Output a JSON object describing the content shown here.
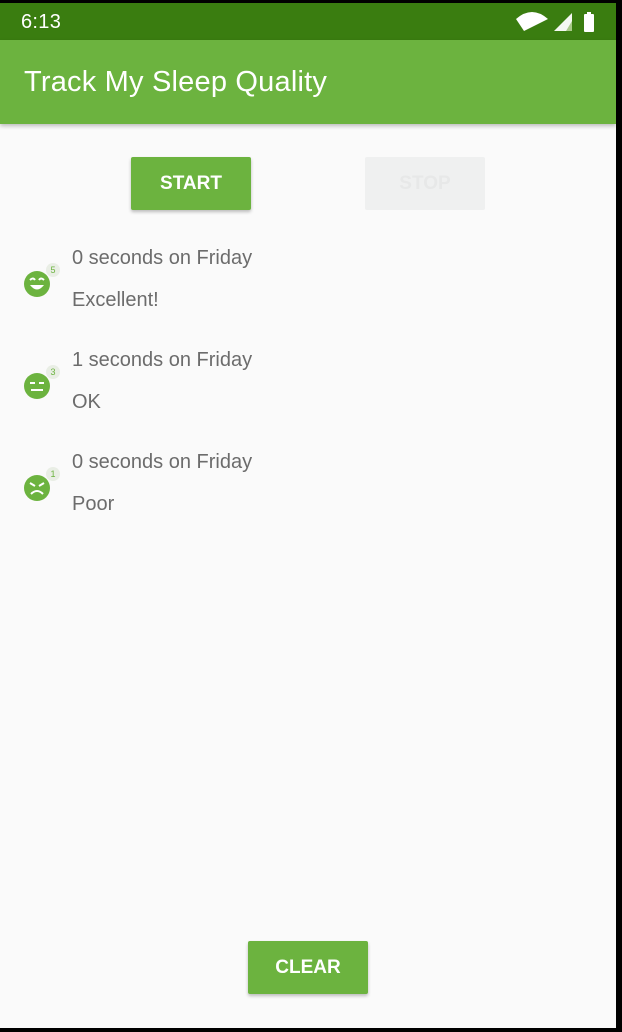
{
  "status_bar": {
    "time": "6:13",
    "icons": [
      "wifi-icon",
      "signal-icon",
      "battery-icon"
    ]
  },
  "app_bar": {
    "title": "Track My Sleep Quality"
  },
  "buttons": {
    "start": "START",
    "stop": "STOP",
    "clear": "CLEAR"
  },
  "nights": [
    {
      "duration": "0 seconds on Friday",
      "quality": "Excellent!",
      "rating": "5",
      "icon": "excellent-face-icon"
    },
    {
      "duration": "1 seconds on Friday",
      "quality": "OK",
      "rating": "3",
      "icon": "ok-face-icon"
    },
    {
      "duration": "0 seconds on Friday",
      "quality": "Poor",
      "rating": "1",
      "icon": "poor-face-icon"
    }
  ],
  "colors": {
    "status_bar": "#3a7d10",
    "app_bar": "#6cb33f",
    "accent": "#6cb33f",
    "disabled_button": "#eff0f0",
    "text_secondary": "#6c6c6c"
  }
}
